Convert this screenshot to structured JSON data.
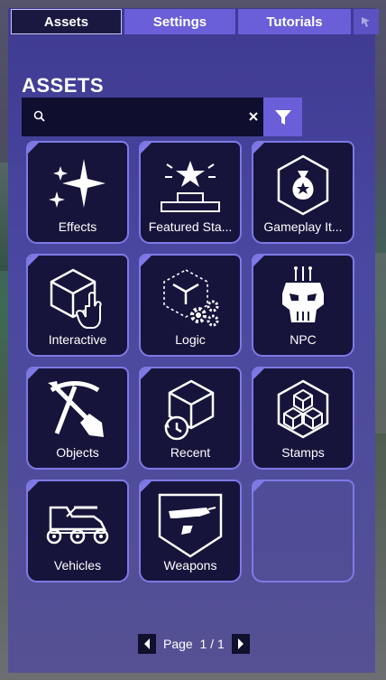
{
  "tabs": [
    {
      "label": "Assets",
      "active": true
    },
    {
      "label": "Settings",
      "active": false
    },
    {
      "label": "Tutorials",
      "active": false
    }
  ],
  "extra_tab_icon": "cursor-icon",
  "section_title": "ASSETS",
  "search": {
    "value": "",
    "placeholder": ""
  },
  "tiles": [
    {
      "label": "Effects",
      "icon": "sparkles-icon"
    },
    {
      "label": "Featured Sta...",
      "icon": "star-podium-icon"
    },
    {
      "label": "Gameplay It...",
      "icon": "item-bag-icon"
    },
    {
      "label": "Interactive",
      "icon": "cube-cursor-icon"
    },
    {
      "label": "Logic",
      "icon": "cube-gears-icon"
    },
    {
      "label": "NPC",
      "icon": "robot-skull-icon"
    },
    {
      "label": "Objects",
      "icon": "pickaxe-shovel-icon"
    },
    {
      "label": "Recent",
      "icon": "cube-history-icon"
    },
    {
      "label": "Stamps",
      "icon": "stacked-cubes-icon"
    },
    {
      "label": "Vehicles",
      "icon": "vehicle-icon"
    },
    {
      "label": "Weapons",
      "icon": "blaster-icon"
    },
    {
      "label": "",
      "icon": ""
    }
  ],
  "pagination": {
    "label": "Page",
    "value": "1 / 1"
  },
  "colors": {
    "panel": "#4a47a3",
    "tab_inactive": "#6a5fd9",
    "card_bg": "#16143b",
    "card_border": "#7f79e6"
  }
}
